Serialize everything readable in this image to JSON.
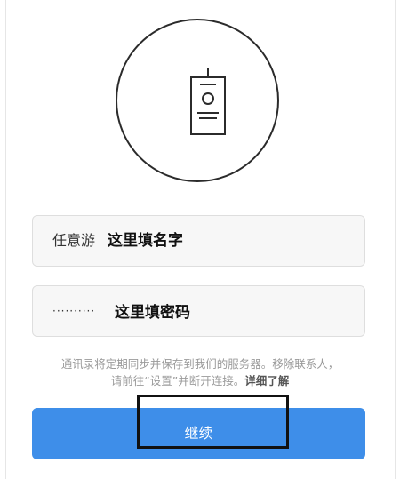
{
  "form": {
    "name_value": "任意游",
    "name_hint": "这里填名字",
    "password_mask": "··········",
    "password_hint": "这里填密码"
  },
  "notice": {
    "text_line1": "通讯录将定期同步并保存到我们的服务器。移除联系人，",
    "text_line2": "请前往“设置”并断开连接。",
    "link_label": "详细了解"
  },
  "continue_button": {
    "label": "继续"
  },
  "colors": {
    "accent": "#3e8ee9",
    "field_background": "#f7f7f7",
    "muted_text": "#9a9a9a"
  },
  "icons": {
    "avatar": "id-badge-icon"
  }
}
